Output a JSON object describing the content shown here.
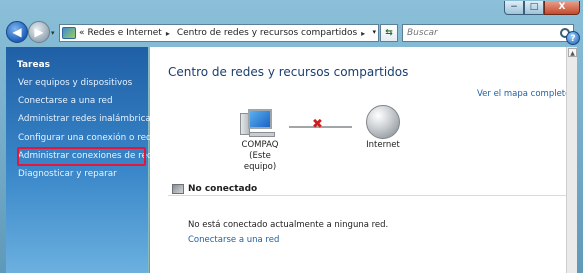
{
  "window": {
    "min_glyph": "−",
    "max_glyph": "□",
    "close_glyph": "X"
  },
  "nav": {
    "back_glyph": "◀",
    "forward_glyph": "▶",
    "dropdown_glyph": "▾",
    "refresh_glyph": "⇆"
  },
  "address": {
    "prefix": "«",
    "crumbs": [
      "Redes e Internet",
      "Centro de redes y recursos compartidos"
    ],
    "separator": "▸",
    "dropdown_glyph": "▾"
  },
  "search": {
    "placeholder": "Buscar"
  },
  "help": {
    "glyph": "?"
  },
  "sidebar": {
    "title": "Tareas",
    "items": [
      {
        "label": "Ver equipos y dispositivos"
      },
      {
        "label": "Conectarse a una red"
      },
      {
        "label": "Administrar redes inalámbricas"
      },
      {
        "label": "Configurar una conexión o red"
      },
      {
        "label": "Administrar conexiones de red",
        "highlighted": true
      },
      {
        "label": "Diagnosticar y reparar"
      }
    ]
  },
  "main": {
    "title": "Centro de redes y recursos compartidos",
    "map_link": "Ver el mapa completo",
    "computer": {
      "name": "COMPAQ",
      "subtitle": "(Este equipo)"
    },
    "connection_status_icon": "red-x-icon",
    "connection_glyph": "✖",
    "internet": {
      "name": "Internet"
    },
    "section_title": "No conectado",
    "status_message": "No está conectado actualmente a ninguna red.",
    "connect_link": "Conectarse a una red"
  },
  "scrollbar": {
    "up_glyph": "▲"
  },
  "colors": {
    "link": "#1d5fa7",
    "highlight_border": "#e3173b",
    "sidebar_top": "#1f5fa6",
    "sidebar_bottom": "#6bb0df",
    "disconnect_x": "#d21a1a"
  }
}
